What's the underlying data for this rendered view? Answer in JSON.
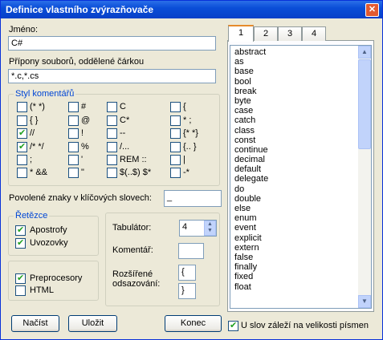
{
  "window": {
    "title": "Definice vlastního zvýrazňovače",
    "close": "✕"
  },
  "name_label": "Jméno:",
  "name_value": "C#",
  "ext_label": "Přípony souborů, oddělené čárkou",
  "ext_value": "*.c,*.cs",
  "comments": {
    "legend": "Styl komentářů",
    "items": [
      {
        "label": "(* *)",
        "checked": false
      },
      {
        "label": "#",
        "checked": false
      },
      {
        "label": "C",
        "checked": false
      },
      {
        "label": "{",
        "checked": false
      },
      {
        "label": "{ }",
        "checked": false
      },
      {
        "label": "@",
        "checked": false
      },
      {
        "label": "C*",
        "checked": false
      },
      {
        "label": "* ;",
        "checked": false
      },
      {
        "label": "//",
        "checked": true
      },
      {
        "label": "!",
        "checked": false
      },
      {
        "label": "--",
        "checked": false
      },
      {
        "label": "{* *}",
        "checked": false
      },
      {
        "label": "/* */",
        "checked": true
      },
      {
        "label": "%",
        "checked": false
      },
      {
        "label": "/...",
        "checked": false
      },
      {
        "label": "{.. }",
        "checked": false
      },
      {
        "label": ";",
        "checked": false
      },
      {
        "label": "'",
        "checked": false
      },
      {
        "label": "REM ::",
        "checked": false
      },
      {
        "label": "|",
        "checked": false
      },
      {
        "label": "* &&",
        "checked": false
      },
      {
        "label": "\"",
        "checked": false
      },
      {
        "label": "$(..$) $*",
        "checked": false
      },
      {
        "label": "-*",
        "checked": false
      }
    ]
  },
  "keyword_chars_label": "Povolené znaky v klíčových slovech:",
  "keyword_chars_value": "_",
  "strings": {
    "legend": "Řetězce",
    "apostrofy": "Apostrofy",
    "uvozovky": "Uvozovky"
  },
  "preprocesory": "Preprocesory",
  "html": "HTML",
  "tabulator_label": "Tabulátor:",
  "tabulator_value": "4",
  "komentar_label": "Komentář:",
  "komentar_value": "",
  "indent_label_1": "Rozšířené",
  "indent_label_2": "odsazování:",
  "indent_open": "{",
  "indent_close": "}",
  "buttons": {
    "load": "Načíst",
    "save": "Uložit",
    "end": "Konec"
  },
  "case_sensitive": "U slov záleží na velikosti písmen",
  "tabs": [
    "1",
    "2",
    "3",
    "4"
  ],
  "keywords": [
    "abstract",
    "as",
    "base",
    "bool",
    "break",
    "byte",
    "case",
    "catch",
    "class",
    "const",
    "continue",
    "decimal",
    "default",
    "delegate",
    "do",
    "double",
    "else",
    "enum",
    "event",
    "explicit",
    "extern",
    "false",
    "finally",
    "fixed",
    "float"
  ]
}
